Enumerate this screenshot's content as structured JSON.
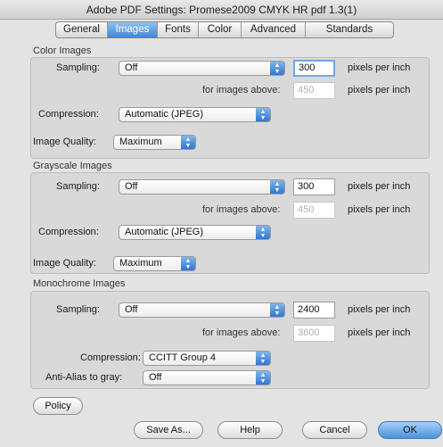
{
  "window": {
    "title": "Adobe PDF Settings: Promese2009 CMYK HR pdf 1.3(1)"
  },
  "tabs": [
    {
      "label": "General"
    },
    {
      "label": "Images"
    },
    {
      "label": "Fonts"
    },
    {
      "label": "Color"
    },
    {
      "label": "Advanced"
    },
    {
      "label": "Standards"
    }
  ],
  "active_tab": "Images",
  "color": {
    "title": "Color Images",
    "sampling_label": "Sampling:",
    "sampling_value": "Off",
    "resolution": "300",
    "resolution_unit": "pixels per inch",
    "above_label": "for images above:",
    "above_value": "450",
    "above_unit": "pixels per inch",
    "compression_label": "Compression:",
    "compression_value": "Automatic (JPEG)",
    "quality_label": "Image Quality:",
    "quality_value": "Maximum"
  },
  "grayscale": {
    "title": "Grayscale Images",
    "sampling_label": "Sampling:",
    "sampling_value": "Off",
    "resolution": "300",
    "resolution_unit": "pixels per inch",
    "above_label": "for images above:",
    "above_value": "450",
    "above_unit": "pixels per inch",
    "compression_label": "Compression:",
    "compression_value": "Automatic (JPEG)",
    "quality_label": "Image Quality:",
    "quality_value": "Maximum"
  },
  "mono": {
    "title": "Monochrome Images",
    "sampling_label": "Sampling:",
    "sampling_value": "Off",
    "resolution": "2400",
    "resolution_unit": "pixels per inch",
    "above_label": "for images above:",
    "above_value": "3600",
    "above_unit": "pixels per inch",
    "compression_label": "Compression:",
    "compression_value": "CCITT Group 4",
    "antialias_label": "Anti-Alias to gray:",
    "antialias_value": "Off"
  },
  "buttons": {
    "policy": "Policy",
    "save_as": "Save As...",
    "help": "Help",
    "cancel": "Cancel",
    "ok": "OK"
  },
  "icons": {
    "popup_arrows": "updown-arrows-icon"
  },
  "colors": {
    "accent": "#3f86d8",
    "panel": "#d9d9d9",
    "window": "#e3e3e3"
  }
}
